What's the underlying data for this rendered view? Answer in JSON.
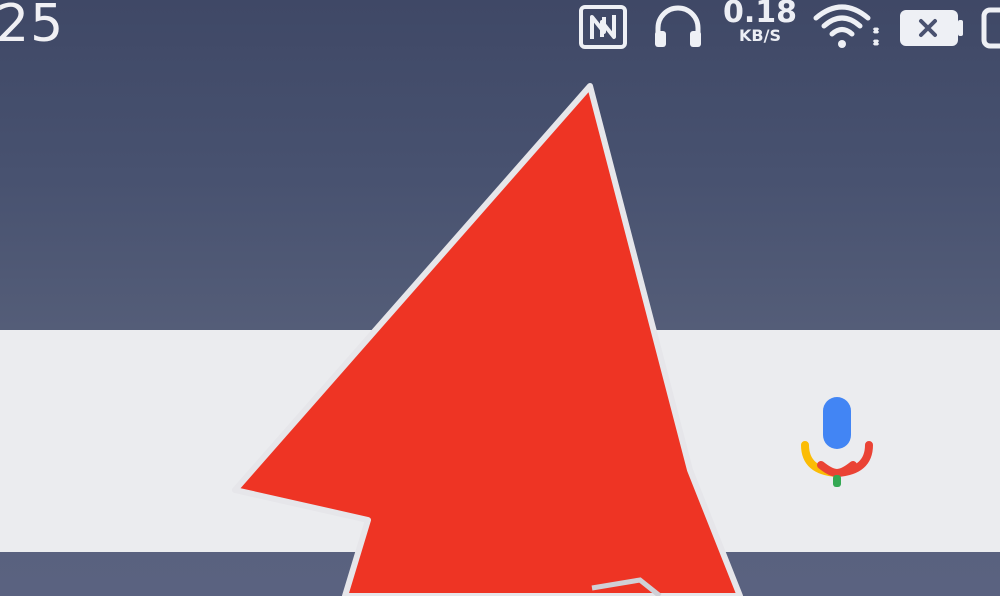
{
  "status_bar": {
    "time": "25",
    "network_speed_value": "0.18",
    "network_speed_unit": "KB/S",
    "icons": [
      "nfc-icon",
      "headphone-icon",
      "wifi-icon",
      "battery-icon"
    ]
  },
  "search": {
    "mic_icon": "microphone-icon"
  },
  "overlay": {
    "arrow_icon": "red-arrow-pointer",
    "arrow_color": "#ee3424"
  },
  "colors": {
    "mic_blue": "#4285f4",
    "mic_red": "#ea4335",
    "mic_yellow": "#fbbc05",
    "mic_green": "#34a853",
    "search_bar_bg": "#ebecef"
  }
}
